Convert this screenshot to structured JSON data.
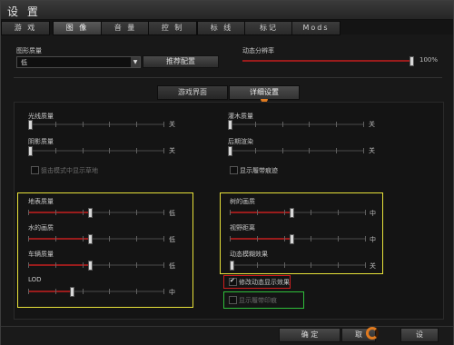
{
  "window": {
    "title": "设 置"
  },
  "tabs": [
    {
      "label": "游 戏",
      "active": false
    },
    {
      "label": "图 像",
      "active": true
    },
    {
      "label": "音 量",
      "active": false
    },
    {
      "label": "控 制",
      "active": false
    },
    {
      "label": "标 线",
      "active": false
    },
    {
      "label": "标记",
      "active": false
    },
    {
      "label": "Mods",
      "active": false
    }
  ],
  "graphics_quality": {
    "label": "图形质量",
    "value": "低",
    "recommend_label": "推荐配置"
  },
  "dynamic_resolution": {
    "label": "动态分辨率",
    "value_text": "100%",
    "value": 1.0
  },
  "subtabs": [
    {
      "label": "游戏界面",
      "active": false
    },
    {
      "label": "详细设置",
      "active": true
    }
  ],
  "left_top_sliders": [
    {
      "label": "光线质量",
      "value_text": "关",
      "value": 0.0
    },
    {
      "label": "阴影质量",
      "value_text": "关",
      "value": 0.0
    }
  ],
  "right_top_sliders": [
    {
      "label": "灌木质量",
      "value_text": "关",
      "value": 0.0
    },
    {
      "label": "后期渲染",
      "value_text": "关",
      "value": 0.0
    }
  ],
  "checkboxes_top": [
    {
      "label": "狙击模式中显示草地",
      "checked": false,
      "disabled": true
    },
    {
      "label": "显示履带痕迹",
      "checked": false,
      "disabled": false
    }
  ],
  "left_group_sliders": [
    {
      "label": "地表质量",
      "value_text": "低",
      "value": 0.45
    },
    {
      "label": "水的画质",
      "value_text": "低",
      "value": 0.45
    },
    {
      "label": "车辆质量",
      "value_text": "低",
      "value": 0.45
    },
    {
      "label": "LOD",
      "value_text": "中",
      "value": 0.32
    }
  ],
  "right_group_sliders": [
    {
      "label": "树的画质",
      "value_text": "中",
      "value": 0.45
    },
    {
      "label": "视野距离",
      "value_text": "中",
      "value": 0.45
    },
    {
      "label": "动态模糊效果",
      "value_text": "关",
      "value": 0.0
    }
  ],
  "checkboxes_bottom": [
    {
      "label": "修改动态显示效果",
      "checked": true,
      "disabled": false
    },
    {
      "label": "显示履带印痕",
      "checked": false,
      "disabled": true
    }
  ],
  "footer": {
    "ok_label": "确 定",
    "cancel_label": "取",
    "apply_label": "设"
  },
  "colors": {
    "accent": "#e07a1f",
    "slider_fill": "#9a1c1c",
    "highlight_yellow": "#e8e23a",
    "highlight_red": "#d01e1e",
    "highlight_green": "#2fbf3a"
  }
}
